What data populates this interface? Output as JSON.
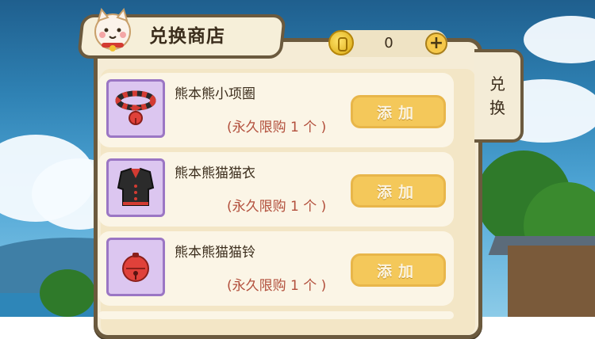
{
  "shop": {
    "title": "兑换商店",
    "side_tab_label": [
      "兑",
      "换"
    ]
  },
  "currency": {
    "icon": "gold-coin-icon",
    "amount": "0",
    "add_symbol": "+"
  },
  "items": [
    {
      "name": "熊本熊小项圈",
      "limit": "(永久限购 1 个 )",
      "button": "添加",
      "icon": "collar-icon"
    },
    {
      "name": "熊本熊猫猫衣",
      "limit": "(永久限购 1 个 )",
      "button": "添加",
      "icon": "cat-clothes-icon"
    },
    {
      "name": "熊本熊猫猫铃",
      "limit": "(永久限购 1 个 )",
      "button": "添加",
      "icon": "bell-icon"
    }
  ],
  "colors": {
    "panel_border": "#6b5a3e",
    "button_fill": "#f4c85a",
    "limit_text": "#b24f3c",
    "thumb_bg": "#dcc6f0"
  }
}
